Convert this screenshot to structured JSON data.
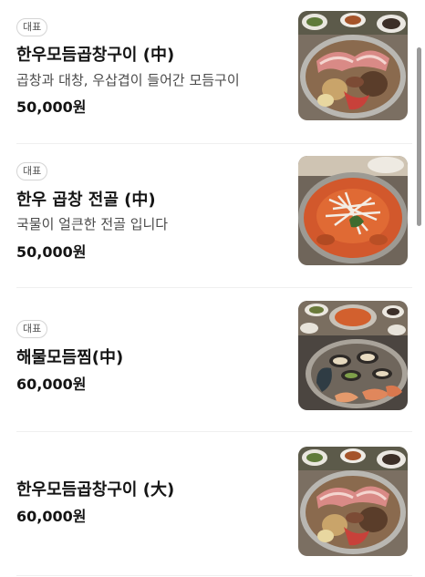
{
  "menu": {
    "items": [
      {
        "badge": "대표",
        "name": "한우모듬곱창구이 (中)",
        "description": "곱창과 대창, 우삽겹이 들어간 모듬구이",
        "price": "50,000원",
        "image": "grilled-tripe-platter-image"
      },
      {
        "badge": "대표",
        "name": "한우 곱창 전골 (中)",
        "description": "국물이 얼큰한 전골 입니다",
        "price": "50,000원",
        "image": "tripe-hotpot-image"
      },
      {
        "badge": "대표",
        "name": "해물모듬찜(中)",
        "description": "",
        "price": "60,000원",
        "image": "seafood-steam-image"
      },
      {
        "badge": "",
        "name": "한우모듬곱창구이 (大)",
        "description": "",
        "price": "60,000원",
        "image": "grilled-tripe-platter-image"
      }
    ]
  }
}
